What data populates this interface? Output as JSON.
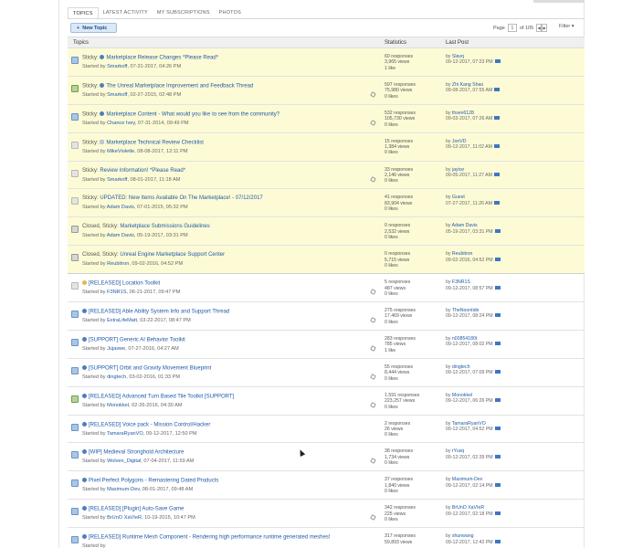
{
  "tabs": [
    "TOPICS",
    "LATEST ACTIVITY",
    "MY SUBSCRIPTIONS",
    "PHOTOS"
  ],
  "new_topic_label": "New Topic",
  "pagination": {
    "label": "Page",
    "current": "1",
    "of_label": "of 105"
  },
  "filter_label": "Filter",
  "columns": {
    "topics": "Topics",
    "statistics": "Statistics",
    "last_post": "Last Post"
  },
  "colors": {
    "sticky_bg": "#fdfbd6",
    "link": "#1f5aa8",
    "button_bg": "#dbe8f6"
  },
  "topics": [
    {
      "prefix": "Sticky:",
      "title": "Marketplace Release Changes *Please Read*",
      "bold": false,
      "starter_label": "Started by",
      "starter": "Smarkoff",
      "date": ", 07-31-2017, 04:26 PM",
      "responses": "60 responses",
      "views": "3,965 views",
      "likes": "1 like",
      "last_user": "Slavq",
      "last_date": "09-12-2017, 07:23 PM",
      "sticky": true,
      "icon": "blue",
      "pi": "blue",
      "clip": false
    },
    {
      "prefix": "Sticky:",
      "title": "The Unreal Marketplace Improvement and Feedback Thread",
      "bold": false,
      "starter_label": "Started by",
      "starter": "Smarkoff",
      "date": ", 02-27-2015, 02:48 PM",
      "responses": "597 responses",
      "views": "75,980 views",
      "likes": "0 likes",
      "last_user": "Zhi Kang Shao",
      "last_date": "09-08-2017, 07:55 AM",
      "sticky": true,
      "icon": "green",
      "pi": "blue",
      "clip": true
    },
    {
      "prefix": "Sticky:",
      "title": "Marketplace Content - What would you like to see from the community?",
      "bold": false,
      "starter_label": "Started by",
      "starter": "Chance Ivey",
      "date": ", 07-31-2014, 09:49 PM",
      "responses": "532 responses",
      "views": "105,730 views",
      "likes": "0 likes",
      "last_user": "thsev6128",
      "last_date": "09-03-2017, 07:26 AM",
      "sticky": true,
      "icon": "blue",
      "pi": "blue",
      "clip": true
    },
    {
      "prefix": "Sticky:",
      "title": "Marketplace Technical Review Checklist",
      "bold": false,
      "starter_label": "Started by",
      "starter": "MikeVioletle",
      "date": ", 08-08-2017, 12:11 PM",
      "responses": "15 responses",
      "views": "1,384 views",
      "likes": "0 likes",
      "last_user": "JonVD",
      "last_date": "09-12-2017, 11:02 AM",
      "sticky": true,
      "icon": "gray",
      "pi": "gray",
      "clip": false
    },
    {
      "prefix": "Sticky:",
      "title": "Review Information! *Please Read*",
      "bold": false,
      "starter_label": "Started by",
      "starter": "Smarkoff",
      "date": ", 08-01-2017, 11:18 AM",
      "responses": "33 responses",
      "views": "2,146 views",
      "likes": "0 likes",
      "last_user": "jayice",
      "last_date": "09-05-2017, 11:27 AM",
      "sticky": true,
      "icon": "gray",
      "pi": "none",
      "clip": true
    },
    {
      "prefix": "Sticky:",
      "title": "UPDATED: New Items Available On The Marketplace! - 07/12/2017",
      "bold": false,
      "starter_label": "Started by",
      "starter": "Adam Davis",
      "date": ", 07-01-2015, 05:32 PM",
      "responses": "41 responses",
      "views": "83,904 views",
      "likes": "0 likes",
      "last_user": "Guest",
      "last_date": "07-27-2017, 11:26 AM",
      "sticky": true,
      "icon": "gray",
      "pi": "none",
      "clip": false
    },
    {
      "prefix": "Closed, Sticky:",
      "title": "Marketplace Submissions Guidelines",
      "bold": false,
      "starter_label": "Started by",
      "starter": "Adam Davis",
      "date": ", 05-19-2017, 03:31 PM",
      "responses": "0 responses",
      "views": "2,532 views",
      "likes": "0 likes",
      "last_user": "Adam Davis",
      "last_date": "05-19-2017, 03:31 PM",
      "sticky": true,
      "icon": "lock",
      "pi": "none",
      "clip": false
    },
    {
      "prefix": "Closed, Sticky:",
      "title": "Unreal Engine Marketplace Support Center",
      "bold": false,
      "starter_label": "Started by",
      "starter": "Reubitron",
      "date": ", 09-02-2016, 04:52 PM",
      "responses": "0 responses",
      "views": "5,715 views",
      "likes": "0 likes",
      "last_user": "Reubitron",
      "last_date": "09-02-2016, 04:52 PM",
      "sticky": true,
      "icon": "lock",
      "pi": "none",
      "clip": false
    },
    {
      "prefix": "",
      "title": "[RELEASED] Location Toolkit",
      "bold": false,
      "starter_label": "Started by",
      "starter": "F3NR1S",
      "date": ", 06-21-2017, 09:47 PM",
      "responses": "5 responses",
      "views": "487 views",
      "likes": "0 likes",
      "last_user": "F3NR1S",
      "last_date": "09-12-2017, 08:57 PM",
      "sticky": false,
      "icon": "gray",
      "pi": "yellow",
      "clip": true
    },
    {
      "prefix": "",
      "title": "[RELEASED] Able Ability System Info and Support Thread",
      "bold": false,
      "starter_label": "Started by",
      "starter": "ExtraLifeMatt",
      "date": ", 03-22-2017, 08:47 PM",
      "responses": "275 responses",
      "views": "17,469 views",
      "likes": "0 likes",
      "last_user": "TheNoontide",
      "last_date": "09-12-2017, 08:24 PM",
      "sticky": false,
      "icon": "blue",
      "pi": "blue",
      "clip": true
    },
    {
      "prefix": "",
      "title": "[SUPPORT] Generic AI Behavior Toolkit",
      "bold": false,
      "starter_label": "Started by",
      "starter": "Jujaswe",
      "date": ", 07-27-2016, 04:27 AM",
      "responses": "283 responses",
      "views": "785 views",
      "likes": "1 like",
      "last_user": "n00854180t",
      "last_date": "09-12-2017, 08:02 PM",
      "sticky": false,
      "icon": "blue",
      "pi": "blue",
      "clip": true
    },
    {
      "prefix": "",
      "title": "[SUPPORT] Orbit and Gravity Movement Blueprint",
      "bold": false,
      "starter_label": "Started by",
      "starter": "dingtech",
      "date": ", 03-02-2016, 01:33 PM",
      "responses": "55 responses",
      "views": "8,444 views",
      "likes": "0 likes",
      "last_user": "dingtech",
      "last_date": "09-12-2017, 07:09 PM",
      "sticky": false,
      "icon": "blue",
      "pi": "blue",
      "clip": true
    },
    {
      "prefix": "",
      "title": "[RELEASED] Advanced Turn Based Tile Toolkit [SUPPORT]",
      "bold": false,
      "starter_label": "Started by",
      "starter": "Monokkel",
      "date": ", 02-26-2016, 04:30 AM",
      "responses": "1,591 responses",
      "views": "223,257 views",
      "likes": "0 likes",
      "last_user": "Monokkel",
      "last_date": "09-12-2017, 06:26 PM",
      "sticky": false,
      "icon": "green",
      "pi": "blue",
      "clip": true
    },
    {
      "prefix": "",
      "title": "[RELEASED] Voice pack - Mission Control/Hacker",
      "bold": false,
      "starter_label": "Started by",
      "starter": "TamaraRyanVO",
      "date": ", 09-12-2017, 12:50 PM",
      "responses": "2 responses",
      "views": "26 views",
      "likes": "0 likes",
      "last_user": "TamaraRyanVO",
      "last_date": "09-12-2017, 04:52 PM",
      "sticky": false,
      "icon": "blue",
      "pi": "blue",
      "clip": false
    },
    {
      "prefix": "",
      "title": "[WIP] Medieval Stronghold Architecture",
      "bold": false,
      "starter_label": "Started by",
      "starter": "Wolven_Digital",
      "date": ", 07-04-2017, 11:59 AM",
      "responses": "38 responses",
      "views": "1,734 views",
      "likes": "0 likes",
      "last_user": "rYuxq",
      "last_date": "09-12-2017, 02:39 PM",
      "sticky": false,
      "icon": "blue",
      "pi": "blue",
      "clip": true
    },
    {
      "prefix": "",
      "title": "Pixel Perfect Polygons - Remastering Dated Products",
      "bold": false,
      "starter_label": "Started by",
      "starter": "Maximum-Dev",
      "date": ", 08-01-2017, 09:48 AM",
      "responses": "37 responses",
      "views": "1,840 views",
      "likes": "0 likes",
      "last_user": "Maximum-Dev",
      "last_date": "09-12-2017, 02:14 PM",
      "sticky": false,
      "icon": "blue",
      "pi": "blue",
      "clip": false
    },
    {
      "prefix": "",
      "title": "[RELEASED] [Plugin] Auto-Save Game",
      "bold": false,
      "starter_label": "Started by",
      "starter": "BrUnO XaVIeR",
      "date": ", 10-19-2015, 10:47 PM",
      "responses": "342 responses",
      "views": "225 views",
      "likes": "0 likes",
      "last_user": "BrUnO XaVIeR",
      "last_date": "09-12-2017, 02:18 PM",
      "sticky": false,
      "icon": "blue",
      "pi": "blue",
      "clip": true
    },
    {
      "prefix": "",
      "title": "[RELEASED] Runtime Mesh Component - Rendering high performance runtime generated meshes!",
      "bold": false,
      "starter_label": "Started by",
      "starter": "",
      "date": "",
      "responses": "317 responses",
      "views": "59,893 views",
      "likes": "",
      "last_user": "shunwang",
      "last_date": "09-12-2017, 12:42 PM",
      "sticky": false,
      "icon": "blue",
      "pi": "blue",
      "clip": false
    }
  ]
}
